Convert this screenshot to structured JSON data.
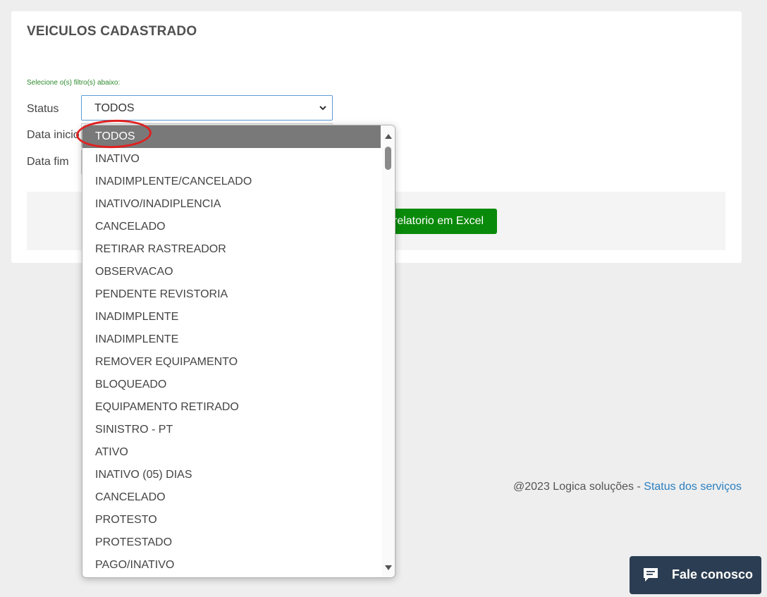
{
  "page": {
    "title": "VEICULOS CADASTRADO",
    "filter_hint": "Selecione o(s) filtro(s) abaixo:"
  },
  "filters": {
    "status_label": "Status",
    "status_value": "TODOS",
    "start_label": "Data inicio",
    "end_label": "Data fim"
  },
  "actions": {
    "export_label": "relatorio em Excel"
  },
  "dropdown": {
    "options": [
      "TODOS",
      "INATIVO",
      "INADIMPLENTE/CANCELADO",
      "INATIVO/INADIPLENCIA",
      "CANCELADO",
      "RETIRAR RASTREADOR",
      "OBSERVACAO",
      "PENDENTE REVISTORIA",
      "INADIMPLENTE",
      "INADIMPLENTE",
      "REMOVER EQUIPAMENTO",
      "BLOQUEADO",
      "EQUIPAMENTO RETIRADO",
      "SINISTRO - PT",
      "ATIVO",
      "INATIVO (05) DIAS",
      "CANCELADO",
      "PROTESTO",
      "PROTESTADO",
      "PAGO/INATIVO"
    ]
  },
  "footer": {
    "copyright": "@2023 Logica soluções - ",
    "status_link": "Status dos serviços"
  },
  "chat": {
    "label": "Fale conosco",
    "icon": "chat-bubble-icon"
  },
  "colors": {
    "export_button": "#0a8a0a",
    "selected_option": "#797979",
    "chat_button": "#2b3d52",
    "highlight_ring": "#e02020",
    "link": "#2a7fc1"
  }
}
